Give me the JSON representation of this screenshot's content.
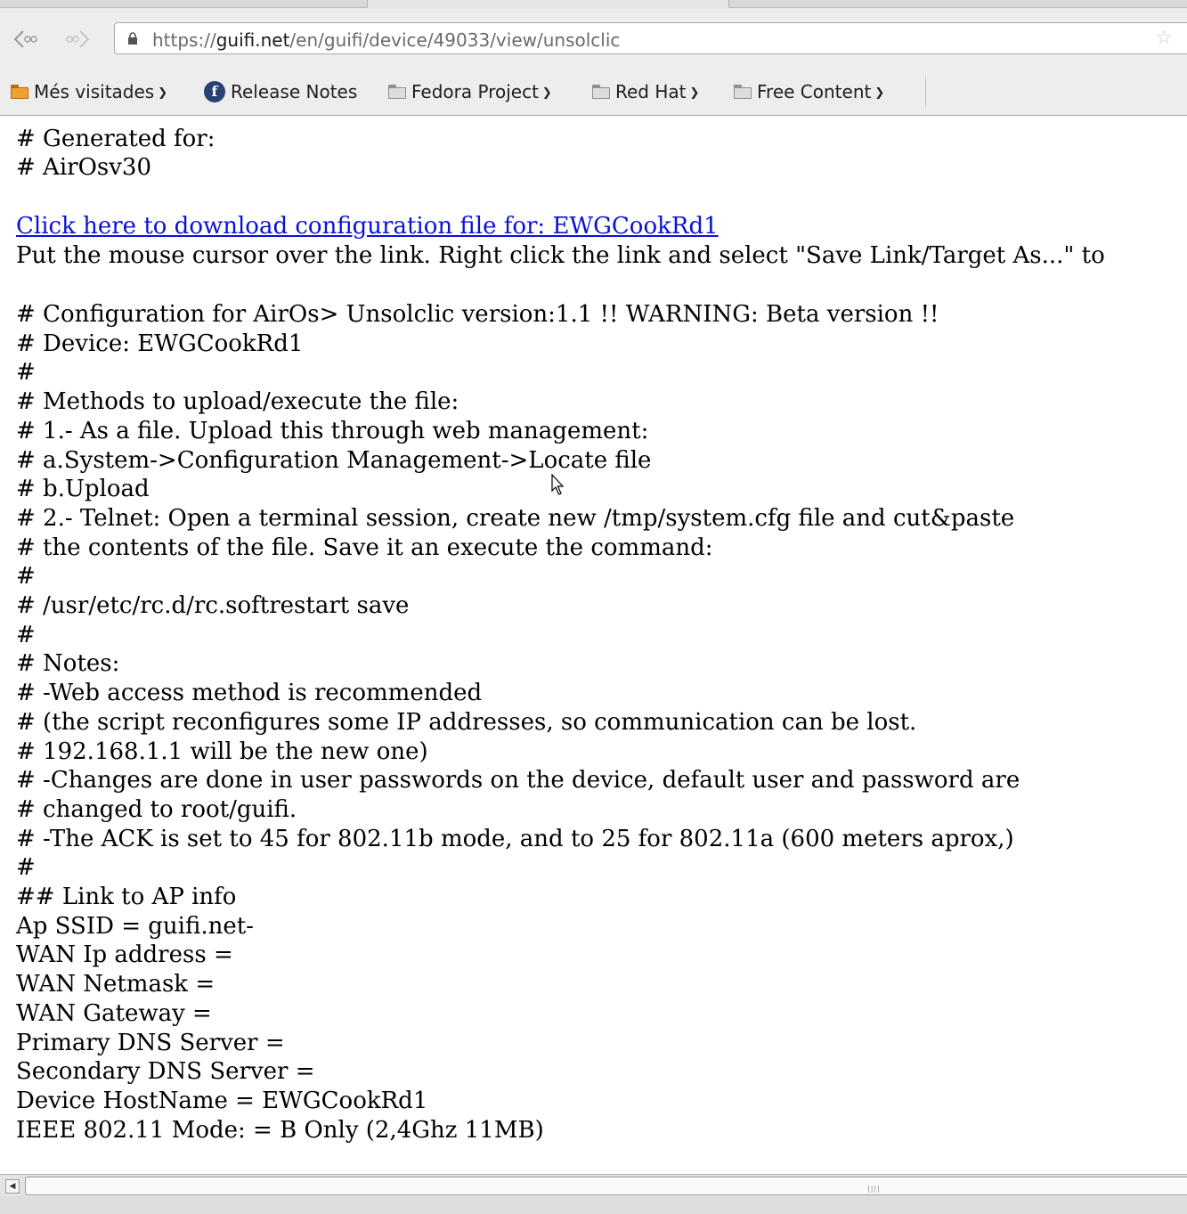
{
  "browser": {
    "url_prefix": "https://",
    "url_domain": "guifi.net",
    "url_path": "/en/guifi/device/49033/view/unsolclic"
  },
  "bookmarks": [
    {
      "label": "Més visitades",
      "icon": "folder-orange-icon",
      "dropdown": true
    },
    {
      "label": "Release Notes",
      "icon": "fedora-icon",
      "dropdown": false
    },
    {
      "label": "Fedora Project",
      "icon": "folder-icon",
      "dropdown": true
    },
    {
      "label": "Red Hat",
      "icon": "folder-icon",
      "dropdown": true
    },
    {
      "label": "Free Content",
      "icon": "folder-icon",
      "dropdown": true
    }
  ],
  "content": {
    "generated_header": [
      "# Generated for:",
      "# AirOsv30"
    ],
    "download_link": "Click here to download configuration file for: EWGCookRd1",
    "download_hint": "Put the mouse cursor over the link. Right click the link and select \"Save Link/Target As...\" to",
    "body_lines": [
      "# Configuration for AirOs> Unsolclic version:1.1 !! WARNING: Beta version !!",
      "# Device: EWGCookRd1",
      "#",
      "# Methods to upload/execute the file:",
      "# 1.- As a file. Upload this through web management:",
      "# a.System->Configuration Management->Locate file",
      "# b.Upload",
      "# 2.- Telnet: Open a terminal session, create new /tmp/system.cfg file and cut&paste",
      "# the contents of the file. Save it an execute the command:",
      "#",
      "# /usr/etc/rc.d/rc.softrestart save",
      "#",
      "# Notes:",
      "# -Web access method is recommended",
      "# (the script reconfigures some IP addresses, so communication can be lost.",
      "# 192.168.1.1 will be the new one)",
      "# -Changes are done in user passwords on the device, default user and password are",
      "# changed to root/guifi.",
      "# -The ACK is set to 45 for 802.11b mode, and to 25 for 802.11a (600 meters aprox,)",
      "#",
      "## Link to AP info",
      "Ap SSID = guifi.net-",
      "WAN Ip address =",
      "WAN Netmask =",
      "WAN Gateway =",
      "Primary DNS Server =",
      "Secondary DNS Server =",
      "Device HostName = EWGCookRd1",
      "IEEE 802.11 Mode: = B Only (2,4Ghz 11MB)"
    ]
  },
  "colors": {
    "link": "#0a11d6",
    "chrome": "#ededed"
  }
}
